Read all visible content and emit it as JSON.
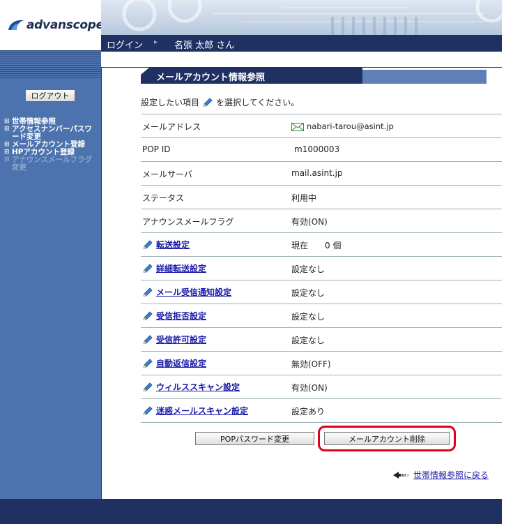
{
  "brand": {
    "logo_text": "advanscope"
  },
  "nav": {
    "login": "ログイン",
    "arrow": "▸",
    "user": "名張 太郎 さん"
  },
  "sidebar": {
    "logout_label": "ログアウト",
    "items": [
      {
        "label": "世帯情報参照",
        "enabled": true
      },
      {
        "label": "アクセスナンバーパスワード変更",
        "enabled": true
      },
      {
        "label": "メールアカウント登録",
        "enabled": true
      },
      {
        "label": "HPアカウント登録",
        "enabled": true
      },
      {
        "label": "アナウンスメールフラグ変更",
        "enabled": false
      }
    ]
  },
  "section": {
    "title": "メールアカウント情報参照"
  },
  "instruction": {
    "before": "設定したい項目",
    "after": "を選択してください。"
  },
  "rows": {
    "email": {
      "label": "メールアドレス",
      "value": "nabari-tarou@asint.jp"
    },
    "pop_id": {
      "label": "POP ID",
      "value": "m1000003"
    },
    "mail_server": {
      "label": "メールサーバ",
      "value": "mail.asint.jp"
    },
    "status": {
      "label": "ステータス",
      "value": "利用中"
    },
    "announce_flag": {
      "label": "アナウンスメールフラグ",
      "value": "有効(ON)"
    },
    "forward": {
      "label": "転送設定",
      "value": "現在　　0 個"
    },
    "detail_forward": {
      "label": "詳細転送設定",
      "value": "設定なし"
    },
    "receive_notify": {
      "label": "メール受信通知設定",
      "value": "設定なし"
    },
    "reject": {
      "label": "受信拒否設定",
      "value": "設定なし"
    },
    "permit": {
      "label": "受信許可設定",
      "value": "設定なし"
    },
    "auto_reply": {
      "label": "自動返信設定",
      "value": "無効(OFF)"
    },
    "virus_scan": {
      "label": "ウィルススキャン設定",
      "value": "有効(ON)"
    },
    "spam_scan": {
      "label": "迷惑メールスキャン設定",
      "value": "設定あり"
    }
  },
  "buttons": {
    "pop_password": "POPパスワード変更",
    "delete_account": "メールアカウント削除"
  },
  "back": {
    "label": "世帯情報参照に戻る"
  },
  "colors": {
    "navy": "#1f3163",
    "sidebar": "#4d73ae",
    "link": "#1a1aa8",
    "highlight": "#e0001b"
  },
  "icons": {
    "pen": "pencil-icon",
    "mail": "envelope-icon",
    "back": "back-arrow-icon"
  }
}
